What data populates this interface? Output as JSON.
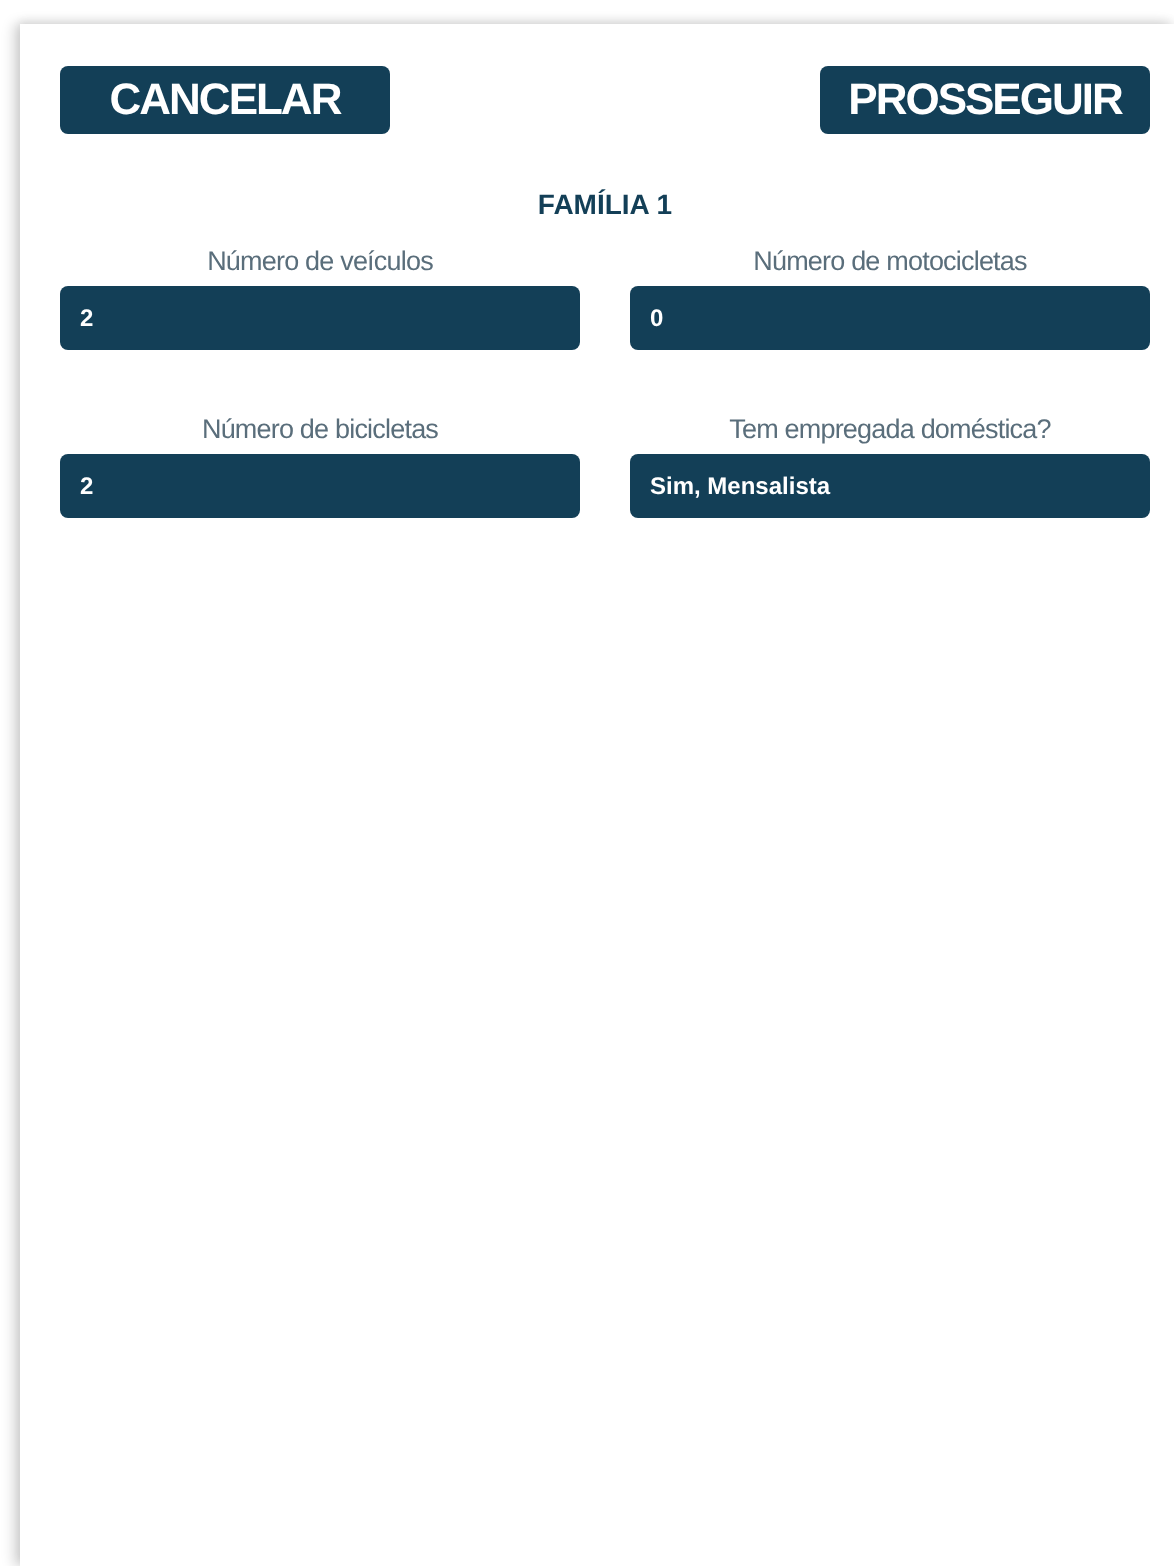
{
  "buttons": [
    {
      "label": "CANCELAR"
    },
    {
      "label": "PROSSEGUIR"
    }
  ],
  "section_title": "FAMÍLIA 1",
  "fields": [
    {
      "label": "Número de veículos",
      "value": "2"
    },
    {
      "label": "Número de motocicletas",
      "value": "0"
    },
    {
      "label": "Número de bicicletas",
      "value": "2"
    },
    {
      "label": "Tem empregada doméstica?",
      "value": "Sim, Mensalista"
    }
  ]
}
